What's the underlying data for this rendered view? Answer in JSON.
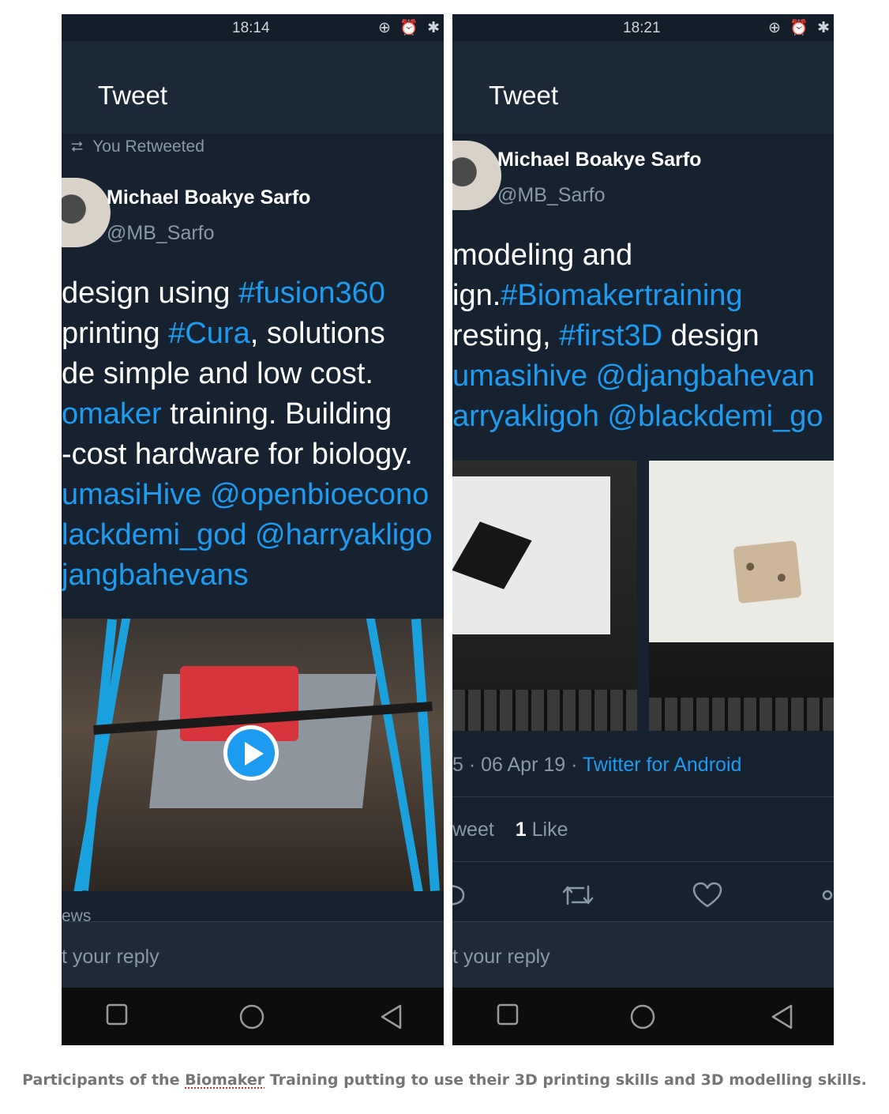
{
  "left_screen": {
    "status_time": "18:14",
    "status_icons": "⊕ ⏰ ✱",
    "header_title": "Tweet",
    "retweet_label": "You Retweeted",
    "author_name": "Michael Boakye Sarfo",
    "author_handle": "@MB_Sarfo",
    "tweet_lines": [
      [
        {
          "t": "design using ",
          "hl": false
        },
        {
          "t": "#fusion360",
          "hl": true
        }
      ],
      [
        {
          "t": " printing ",
          "hl": false
        },
        {
          "t": "#Cura",
          "hl": true
        },
        {
          "t": ", solutions",
          "hl": false
        }
      ],
      [
        {
          "t": "de simple and low cost.",
          "hl": false
        }
      ],
      [
        {
          "t": "omaker",
          "hl": true
        },
        {
          "t": " training. Building",
          "hl": false
        }
      ],
      [
        {
          "t": "-cost hardware for biology.",
          "hl": false
        }
      ],
      [
        {
          "t": "umasiHive @openbioecono",
          "hl": true
        }
      ],
      [
        {
          "t": "lackdemi_god @harryakligo",
          "hl": true
        }
      ],
      [
        {
          "t": "jangbahevans",
          "hl": true
        }
      ]
    ],
    "views_label": "ews",
    "reply_placeholder": "t your reply"
  },
  "right_screen": {
    "status_time": "18:21",
    "status_icons": "⊕ ⏰ ✱",
    "header_title": "Tweet",
    "author_name": "Michael Boakye Sarfo",
    "author_handle": "@MB_Sarfo",
    "tweet_lines": [
      [
        {
          "t": "modeling and",
          "hl": false
        }
      ],
      [
        {
          "t": "ign.",
          "hl": false
        },
        {
          "t": "#Biomakertraining",
          "hl": true
        }
      ],
      [
        {
          "t": "resting, ",
          "hl": false
        },
        {
          "t": "#first3D",
          "hl": true
        },
        {
          "t": " design",
          "hl": false
        }
      ],
      [
        {
          "t": "umasihive @djangbahevan",
          "hl": true
        }
      ],
      [
        {
          "t": "arryakligoh @blackdemi_go",
          "hl": true
        }
      ]
    ],
    "meta_date": "5 · 06 Apr 19 · ",
    "meta_source": "Twitter for Android",
    "stats_retweet_label": "weet",
    "stats_like_count": "1",
    "stats_like_label": "Like",
    "reply_placeholder": "t your reply"
  },
  "icons": {
    "nav": [
      "square-icon",
      "circle-icon",
      "triangle-back-icon"
    ],
    "actions": [
      "reply-icon",
      "retweet-icon",
      "heart-icon",
      "share-icon"
    ],
    "media": "play-icon"
  },
  "colors": {
    "background": "#172230",
    "header": "#1b2838",
    "link": "#1d9bf0",
    "muted": "#8899a6",
    "text": "#ffffff",
    "caption": "#757575"
  },
  "caption": {
    "before": "Participants of the ",
    "flagged": "Biomaker",
    "after": " Training putting to use their 3D printing skills and 3D modelling skills."
  }
}
